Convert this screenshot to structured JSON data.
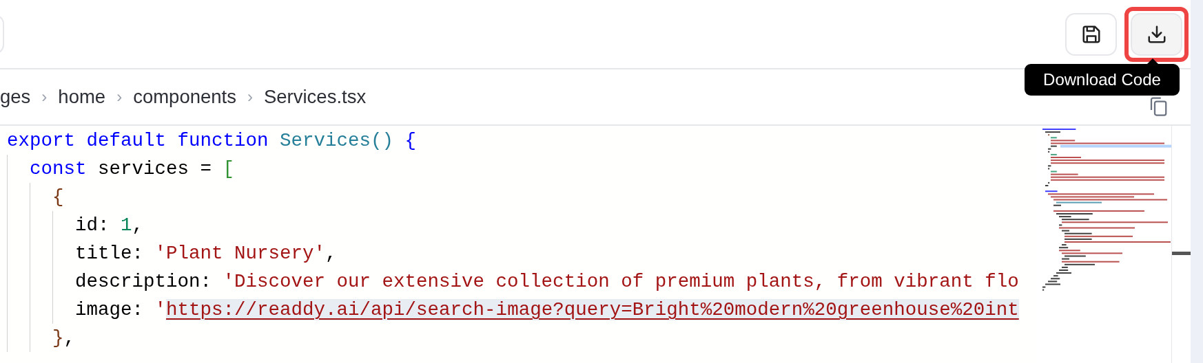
{
  "toolbar": {
    "buttons": [
      {
        "kind": "save",
        "highlighted": false
      },
      {
        "kind": "download",
        "highlighted": true
      }
    ]
  },
  "tooltip": {
    "text": "Download Code"
  },
  "breadcrumb": [
    {
      "label": "ges"
    },
    {
      "separator": "›",
      "label": "home"
    },
    {
      "separator": "›",
      "label": "components"
    },
    {
      "separator": "›",
      "label": "Services.tsx"
    }
  ],
  "code": {
    "lines": [
      {
        "tokens": [
          {
            "kind": "keyword",
            "text": "export default function "
          },
          {
            "kind": "function",
            "text": "Services() "
          },
          {
            "kind": "bracket",
            "color": "#0000ff",
            "text": "{"
          }
        ],
        "children": [
          {
            "tokens": [
              {
                "kind": "keyword",
                "text": "const "
              },
              {
                "kind": "text",
                "text": "services = "
              },
              {
                "kind": "bracket",
                "color": "#319331",
                "text": "["
              }
            ],
            "children": [
              {
                "tokens": [
                  {
                    "kind": "bracket",
                    "color": "#7b3814",
                    "text": "{"
                  }
                ],
                "children": [
                  {
                    "tokens": [
                      {
                        "kind": "text",
                        "text": "id: "
                      },
                      {
                        "kind": "number",
                        "text": "1"
                      },
                      {
                        "kind": "text",
                        "text": ","
                      }
                    ]
                  },
                  {
                    "tokens": [
                      {
                        "kind": "text",
                        "text": "title: "
                      },
                      {
                        "kind": "string",
                        "text": "'Plant Nursery'"
                      },
                      {
                        "kind": "text",
                        "text": ","
                      }
                    ]
                  },
                  {
                    "tokens": [
                      {
                        "kind": "text",
                        "text": "description: "
                      },
                      {
                        "kind": "string",
                        "text": "'Discover our extensive collection of premium plants, from vibrant flo"
                      }
                    ]
                  },
                  {
                    "tokens": [
                      {
                        "kind": "text",
                        "text": "image: "
                      },
                      {
                        "kind": "string",
                        "text": "'"
                      },
                      {
                        "kind": "link",
                        "text": "https://readdy.ai/api/search-image?query=Bright%20modern%20greenhouse%20int"
                      }
                    ]
                  }
                ]
              },
              {
                "tokens": [
                  {
                    "kind": "bracket",
                    "color": "#7b3814",
                    "text": "}"
                  },
                  {
                    "kind": "text",
                    "text": ","
                  }
                ]
              }
            ]
          }
        ]
      }
    ]
  }
}
